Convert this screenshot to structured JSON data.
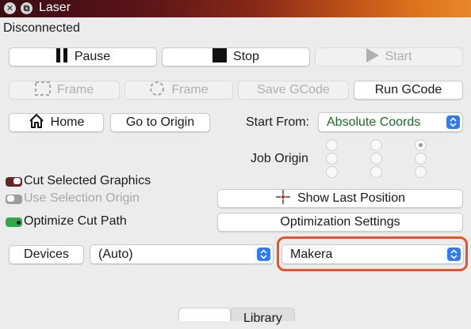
{
  "window": {
    "title": "Laser"
  },
  "status_text": "Disconnected",
  "row1": {
    "pause": "Pause",
    "stop": "Stop",
    "start": "Start"
  },
  "row2": {
    "frame_rect": "Frame",
    "frame_circle": "Frame",
    "save_gcode": "Save GCode",
    "run_gcode": "Run GCode"
  },
  "row3": {
    "home": "Home",
    "go_to_origin": "Go to Origin",
    "start_from_label": "Start From:",
    "start_from_value": "Absolute Coords"
  },
  "job_origin": {
    "label": "Job Origin",
    "selected": "top-right"
  },
  "options": {
    "cut_selected_graphics": {
      "label": "Cut Selected Graphics",
      "state": "on"
    },
    "use_selection_origin": {
      "label": "Use Selection Origin",
      "state": "off-disabled"
    },
    "optimize_cut_path": {
      "label": "Optimize Cut Path",
      "state": "on"
    }
  },
  "buttons": {
    "show_last_position": "Show Last Position",
    "optimization_settings": "Optimization Settings"
  },
  "devices": {
    "button": "Devices",
    "port_value": "(Auto)",
    "device_value": "Makera"
  },
  "tabs": {
    "library": "Library"
  },
  "colors": {
    "highlight": "#e8542a",
    "select_arrow": "#2f7bf5",
    "toggle_on_red": "#6b2226",
    "toggle_on_green": "#2ea84a"
  }
}
